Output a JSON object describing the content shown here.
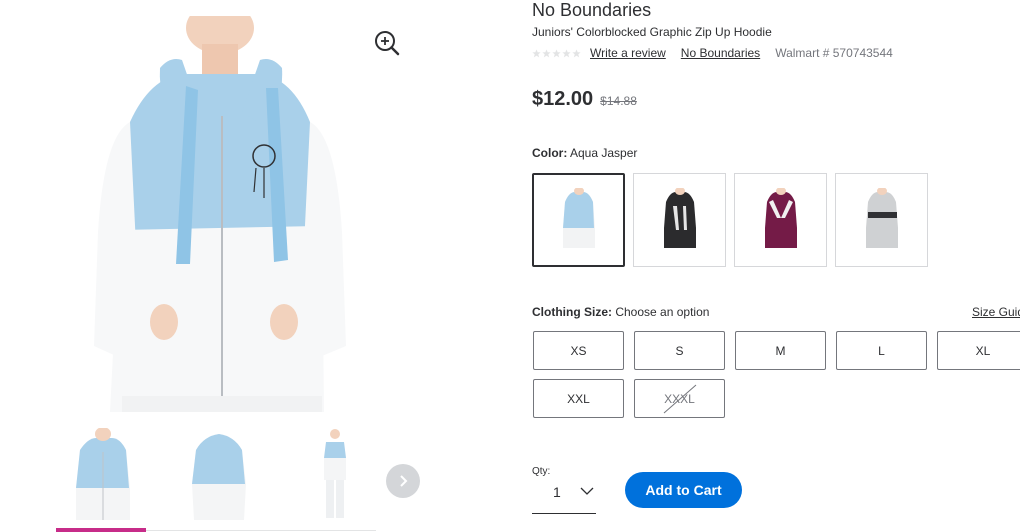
{
  "product": {
    "brand_title": "No Boundaries",
    "name": "Juniors' Colorblocked Graphic Zip Up Hoodie",
    "review_link": "Write a review",
    "brand_link": "No Boundaries",
    "item_number": "Walmart # 570743544",
    "rating": 0,
    "rating_max": 5,
    "price": "$12.00",
    "was_price": "$14.88"
  },
  "gallery": {
    "zoom_icon": "zoom-in-icon",
    "next_icon": "chevron-right-icon",
    "thumbnail_count": 3,
    "active_thumbnail": 0
  },
  "color": {
    "label": "Color:",
    "selected": "Aqua Jasper",
    "swatches": [
      "Aqua Jasper",
      "Black",
      "Burgundy",
      "Gray"
    ]
  },
  "size": {
    "label": "Clothing Size:",
    "prompt": "Choose an option",
    "guide_link": "Size Guide",
    "options": [
      "XS",
      "S",
      "M",
      "L",
      "XL",
      "XXL",
      "XXXL"
    ],
    "unavailable": [
      "XXXL"
    ]
  },
  "quantity": {
    "label": "Qty:",
    "value": "1"
  },
  "cta": {
    "add_to_cart": "Add to Cart"
  },
  "colors": {
    "accent_blue": "#0071dc",
    "active_thumb_bar": "#c72c89",
    "hoodie_light_blue": "#a9d0ea"
  }
}
